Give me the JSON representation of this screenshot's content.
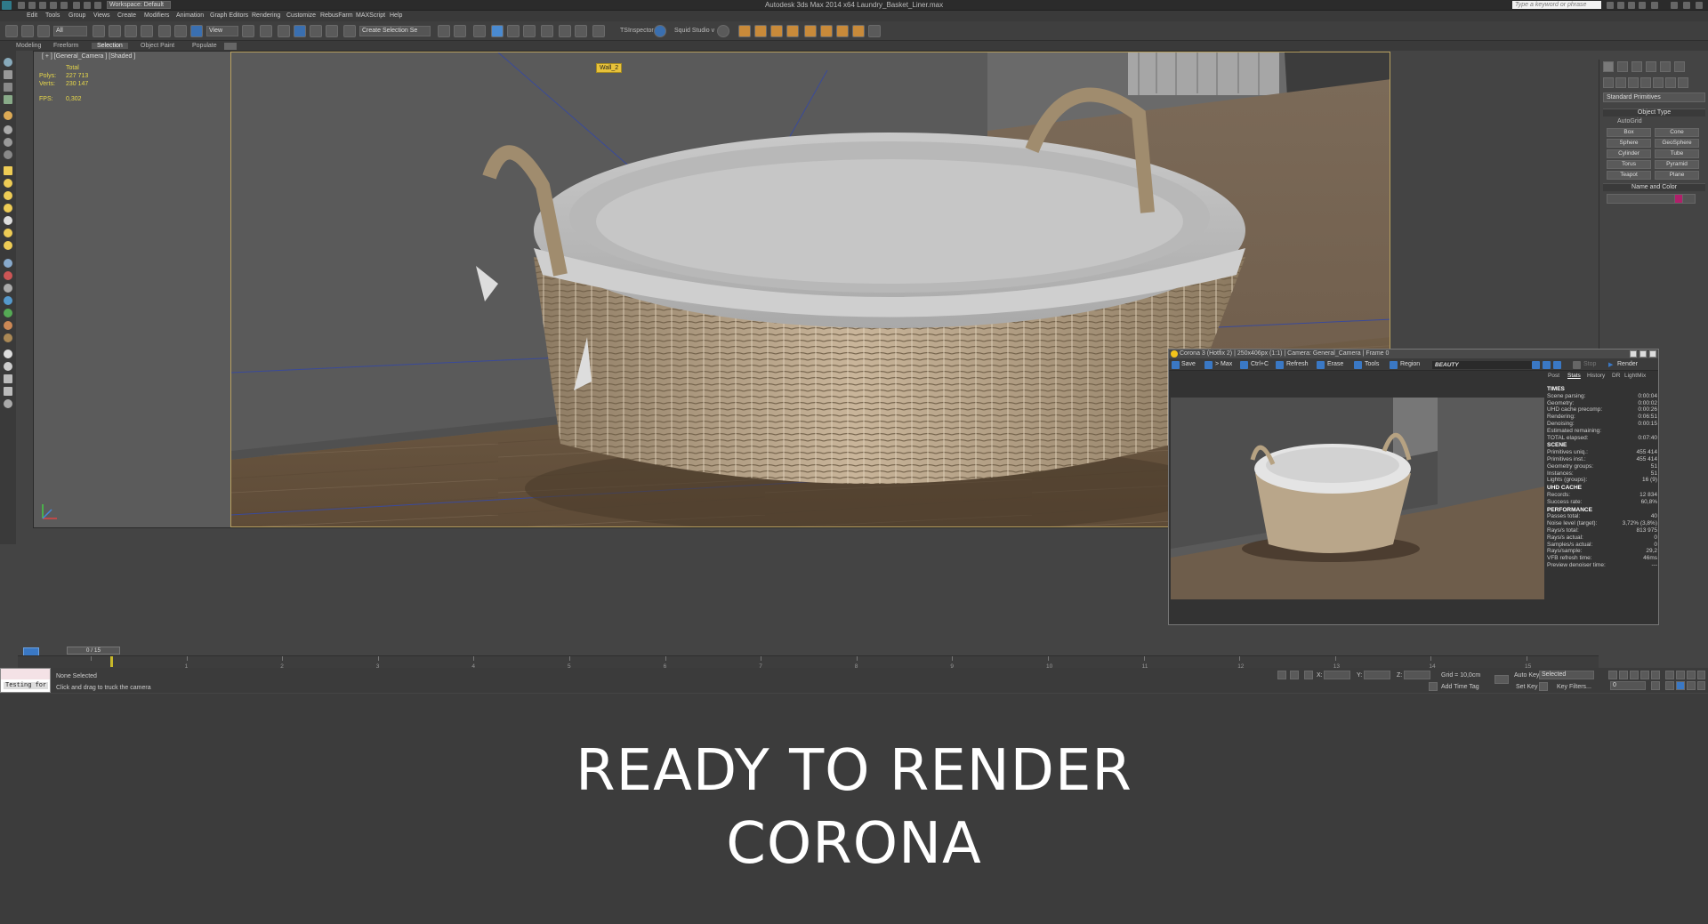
{
  "titlebar": {
    "title": "Autodesk 3ds Max  2014 x64    Laundry_Basket_Liner.max",
    "workspace": "Workspace: Default",
    "search_placeholder": "Type a keyword or phrase"
  },
  "menu": [
    "Edit",
    "Tools",
    "Group",
    "Views",
    "Create",
    "Modifiers",
    "Animation",
    "Graph Editors",
    "Rendering",
    "Customize",
    "RebusFarm",
    "MAXScript",
    "Help"
  ],
  "toolbar": {
    "filter": "All",
    "refcoord": "View",
    "selection_set": "Create Selection Se",
    "tsinspector": "TSInspector",
    "squid": "Squid Studio v"
  },
  "ribbon_tabs": [
    "Modeling",
    "Freeform",
    "Selection",
    "Object Paint",
    "Populate"
  ],
  "ribbon_active": "Selection",
  "viewport": {
    "label": "[ + ] [General_Camera ] [Shaded ]",
    "stats_total": "Total",
    "polys_label": "Polys:",
    "polys_value": "227 713",
    "verts_label": "Verts:",
    "verts_value": "230 147",
    "fps_label": "FPS:",
    "fps_value": "0,302",
    "wall_tag": "Wall_2"
  },
  "command_panel": {
    "dropdown": "Standard Primitives",
    "object_type": "Object Type",
    "autogrid": "AutoGrid",
    "primitives": [
      "Box",
      "Cone",
      "Sphere",
      "GeoSphere",
      "Cylinder",
      "Tube",
      "Torus",
      "Pyramid",
      "Teapot",
      "Plane"
    ],
    "name_and_color": "Name and Color",
    "swatch_color": "#b0206a"
  },
  "vfb": {
    "title": "Corona 3 (Hotfix 2) | 250x406px (1:1) | Camera: General_Camera | Frame 0",
    "buttons": [
      "Save",
      "> Max",
      "Ctrl+C",
      "Refresh",
      "Erase",
      "Tools",
      "Region"
    ],
    "beauty": "BEAUTY",
    "stop": "Stop",
    "render": "Render",
    "tabs": [
      "Post",
      "Stats",
      "History",
      "DR",
      "LightMix"
    ],
    "active_tab": "Stats",
    "sections": [
      {
        "header": "TIMES",
        "rows": [
          [
            "Scene parsing:",
            "0:00:04"
          ],
          [
            "Geometry:",
            "0:00:02"
          ],
          [
            "UHD cache precomp:",
            "0:00:26"
          ],
          [
            "Rendering:",
            "0:06:51"
          ],
          [
            "Denoising:",
            "0:00:15"
          ],
          [
            "Estimated remaining:",
            ""
          ],
          [
            "TOTAL elapsed:",
            "0:07:40"
          ]
        ]
      },
      {
        "header": "SCENE",
        "rows": [
          [
            "Primitives uniq.:",
            "455 414"
          ],
          [
            "Primitives inst.:",
            "455 414"
          ],
          [
            "Geometry groups:",
            "51"
          ],
          [
            "Instances:",
            "51"
          ],
          [
            "Lights (groups):",
            "16 (9)"
          ]
        ]
      },
      {
        "header": "UHD CACHE",
        "rows": [
          [
            "Records:",
            "12 834"
          ],
          [
            "Success rate:",
            "60,8%"
          ]
        ]
      },
      {
        "header": "PERFORMANCE",
        "rows": [
          [
            "Passes total:",
            "40"
          ],
          [
            "Noise level (target):",
            "3,72% (3,8%)"
          ],
          [
            "Rays/s total:",
            "813 975"
          ],
          [
            "Rays/s actual:",
            "0"
          ],
          [
            "Samples/s actual:",
            "0"
          ],
          [
            "Rays/sample:",
            "29,2"
          ],
          [
            "VFB refresh time:",
            "46ms"
          ],
          [
            "Preview denoiser time:",
            "---"
          ]
        ]
      }
    ]
  },
  "timeline": {
    "slider": "0 / 15",
    "ticks": [
      "0",
      "1",
      "2",
      "3",
      "4",
      "5",
      "6",
      "7",
      "8",
      "9",
      "10",
      "11",
      "12",
      "13",
      "14",
      "15"
    ]
  },
  "statusbar": {
    "maxscript": "Testing for",
    "selected": "None Selected",
    "prompt": "Click and drag to truck the camera",
    "x_label": "X:",
    "y_label": "Y:",
    "z_label": "Z:",
    "grid": "Grid = 10,0cm",
    "add_time_tag": "Add Time Tag",
    "auto_key": "Auto Key",
    "auto_key_value": "Selected",
    "set_key": "Set Key",
    "key_filters": "Key Filters...",
    "frame": "0"
  },
  "caption": {
    "line1": "READY TO RENDER",
    "line2": "CORONA"
  }
}
